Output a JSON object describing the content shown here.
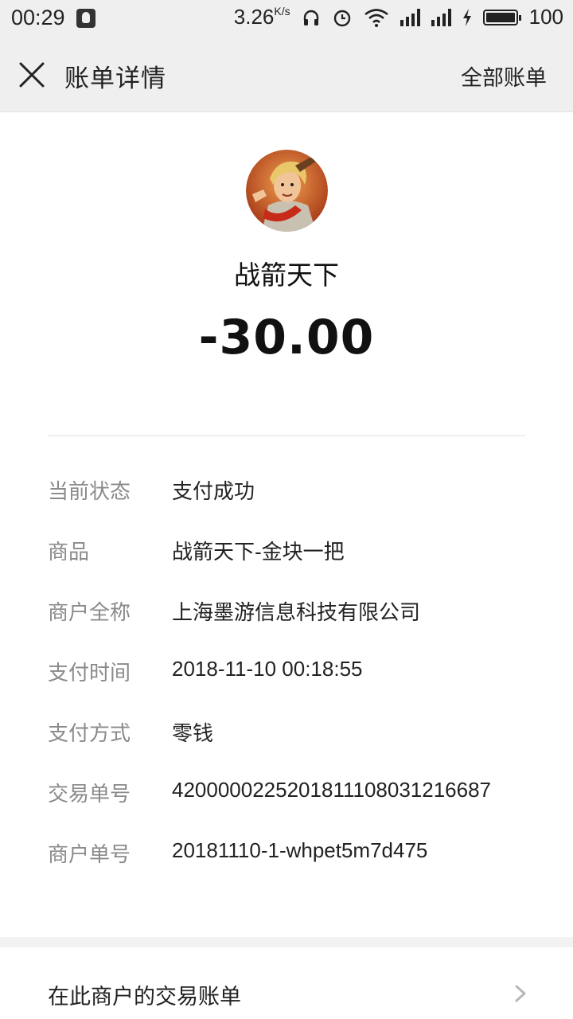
{
  "status_bar": {
    "time": "00:29",
    "speed": "3.26",
    "speed_unit": "K/s",
    "battery": "100"
  },
  "nav": {
    "title": "账单详情",
    "right_link": "全部账单"
  },
  "bill": {
    "merchant_name": "战箭天下",
    "amount": "-30.00",
    "rows": [
      {
        "label": "当前状态",
        "value": "支付成功"
      },
      {
        "label": "商品",
        "value": "战箭天下-金块一把"
      },
      {
        "label": "商户全称",
        "value": "上海墨游信息科技有限公司"
      },
      {
        "label": "支付时间",
        "value": "2018-11-10 00:18:55"
      },
      {
        "label": "支付方式",
        "value": "零钱"
      },
      {
        "label": "交易单号",
        "value": "4200000225201811108031216687"
      },
      {
        "label": "商户单号",
        "value": "20181110-1-whpet5m7d475"
      }
    ]
  },
  "bottom_link": {
    "label": "在此商户的交易账单"
  }
}
